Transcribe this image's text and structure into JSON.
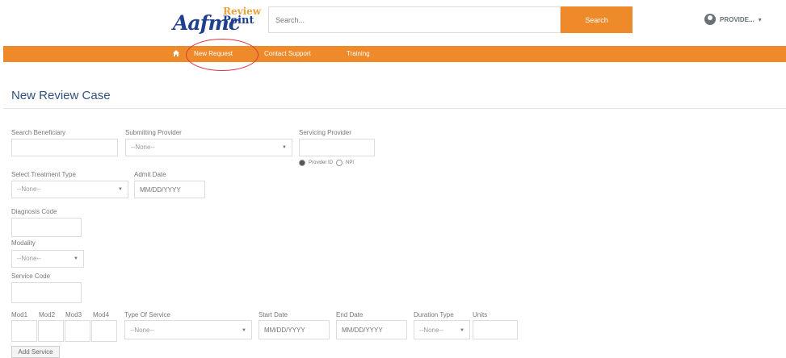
{
  "header": {
    "logo_main": "Aafmc",
    "logo_review": "Review",
    "logo_point": "Point",
    "search_placeholder": "Search...",
    "search_label": "Search",
    "user_name": "PROVIDE...",
    "user_caret": "▾"
  },
  "nav": {
    "home_icon": "home-icon",
    "items": [
      "New Request",
      "Contact Support",
      "Training"
    ],
    "highlight_color": "#d9363e"
  },
  "page": {
    "title": "New Review Case"
  },
  "form": {
    "search_beneficiary_label": "Search Beneficiary",
    "submitting_provider_label": "Submitting Provider",
    "submitting_provider_value": "--None--",
    "servicing_provider_label": "Servicing Provider",
    "radio_provider_id": "Provider ID",
    "radio_npi": "NPI",
    "treatment_type_label": "Select Treatment Type",
    "treatment_type_value": "--None--",
    "admit_date_label": "Admit Date",
    "admit_date_placeholder": "MM/DD/YYYY",
    "diagnosis_code_label": "Diagnosis Code",
    "modality_label": "Modality",
    "modality_value": "--None--",
    "service_code_label": "Service Code",
    "mod1_label": "Mod1",
    "mod2_label": "Mod2",
    "mod3_label": "Mod3",
    "mod4_label": "Mod4",
    "type_of_service_label": "Type Of Service",
    "type_of_service_value": "--None--",
    "start_date_label": "Start Date",
    "start_date_placeholder": "MM/DD/YYYY",
    "end_date_label": "End Date",
    "end_date_placeholder": "MM/DD/YYYY",
    "duration_type_label": "Duration Type",
    "duration_type_value": "--None--",
    "units_label": "Units",
    "add_service_label": "Add Service"
  },
  "colors": {
    "accent_orange": "#ef8a2a",
    "brand_blue": "#1f3f8f",
    "title_blue": "#30507e"
  }
}
